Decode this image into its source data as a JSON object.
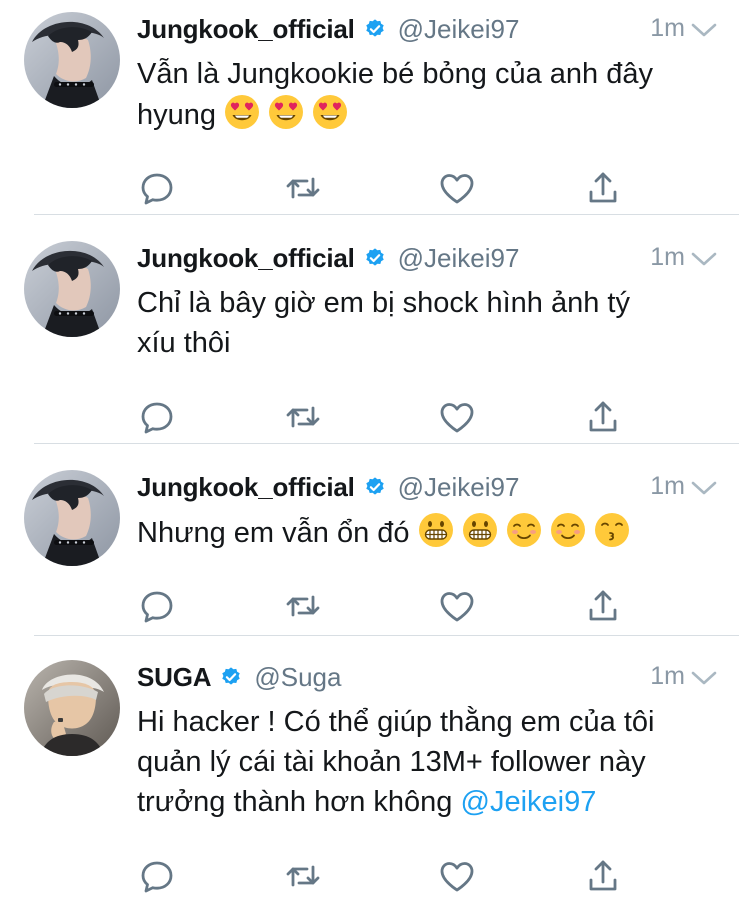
{
  "colors": {
    "accent": "#1da1f2",
    "verified": "#1da1f2",
    "secondary_text": "#657786",
    "divider": "#d8dee3"
  },
  "tweets": [
    {
      "name": "Jungkook_official",
      "handle": "@Jeikei97",
      "time": "1m",
      "text_lines": [
        "Vẫn là Jungkookie bé bỏng của anh đây",
        "hyung"
      ],
      "emojis": [
        "heart-eyes-emoji",
        "heart-eyes-emoji",
        "heart-eyes-emoji"
      ],
      "actions": [
        "reply-icon",
        "retweet-icon",
        "like-icon",
        "share-icon"
      ]
    },
    {
      "name": "Jungkook_official",
      "handle": "@Jeikei97",
      "time": "1m",
      "text_lines": [
        "Chỉ là bây giờ em bị shock hình ảnh tý",
        "xíu thôi"
      ],
      "emojis": [],
      "actions": [
        "reply-icon",
        "retweet-icon",
        "like-icon",
        "share-icon"
      ]
    },
    {
      "name": "Jungkook_official",
      "handle": "@Jeikei97",
      "time": "1m",
      "text_lines": [
        "Nhưng em vẫn ổn đó"
      ],
      "emojis": [
        "grimacing-emoji",
        "grimacing-emoji",
        "smiling-emoji",
        "smiling-emoji",
        "kissing-emoji"
      ],
      "actions": [
        "reply-icon",
        "retweet-icon",
        "like-icon",
        "share-icon"
      ]
    },
    {
      "name": "SUGA",
      "handle": "@Suga",
      "time": "1m",
      "text_lines": [
        "Hi hacker ! Có thể giúp thằng em của tôi",
        "quản lý cái tài khoản 13M+ follower này",
        "trưởng thành hơn không"
      ],
      "mention": "@Jeikei97",
      "emojis": [],
      "actions": [
        "reply-icon",
        "retweet-icon",
        "like-icon",
        "share-icon"
      ]
    }
  ]
}
